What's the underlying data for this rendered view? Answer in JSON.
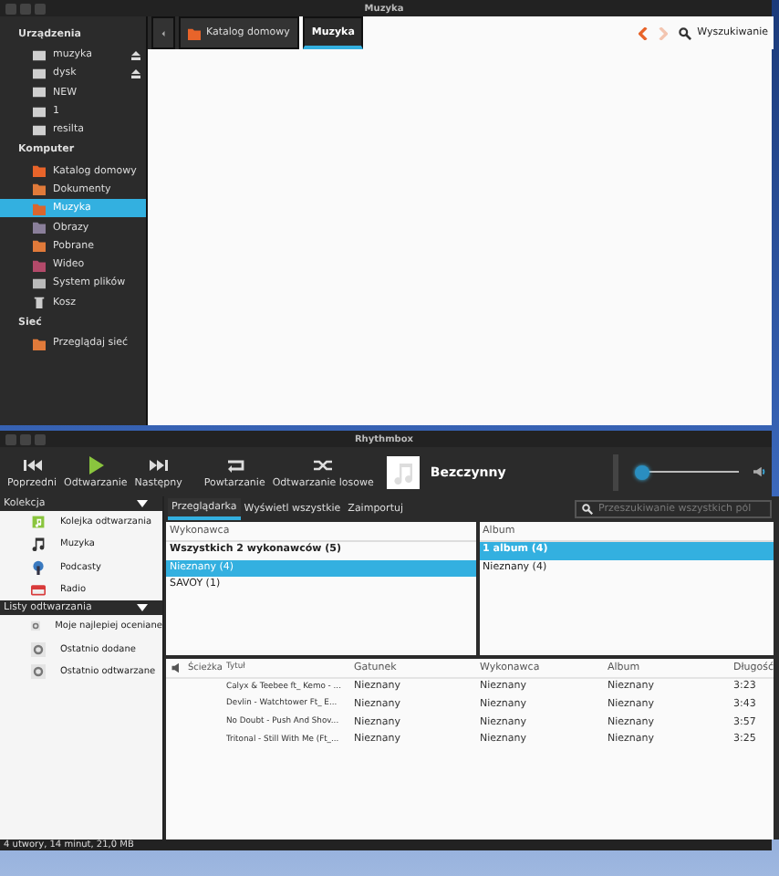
{
  "file_manager": {
    "title": "Muzyka",
    "sidebar": [
      {
        "heading": "Urządzenia",
        "items": [
          {
            "label": "muzyka",
            "ejectable": true,
            "selected": false
          },
          {
            "label": "dysk",
            "ejectable": true,
            "selected": false
          },
          {
            "label": "NEW",
            "ejectable": false,
            "selected": false
          },
          {
            "label": "1",
            "ejectable": false,
            "selected": false
          },
          {
            "label": "resilta",
            "ejectable": false,
            "selected": false
          }
        ]
      },
      {
        "heading": "Komputer",
        "items": [
          {
            "label": "Katalog domowy",
            "ejectable": false,
            "selected": false
          },
          {
            "label": "Dokumenty",
            "ejectable": false,
            "selected": false
          },
          {
            "label": "Muzyka",
            "ejectable": false,
            "selected": true
          },
          {
            "label": "Obrazy",
            "ejectable": false,
            "selected": false
          },
          {
            "label": "Pobrane",
            "ejectable": false,
            "selected": false
          },
          {
            "label": "Wideo",
            "ejectable": false,
            "selected": false
          },
          {
            "label": "System plików",
            "ejectable": false,
            "selected": false
          },
          {
            "label": "Kosz",
            "ejectable": false,
            "selected": false
          }
        ]
      },
      {
        "heading": "Sieć",
        "items": [
          {
            "label": "Przeglądaj sieć",
            "ejectable": false,
            "selected": false
          }
        ]
      }
    ],
    "pathbar": [
      {
        "label": "Katalog domowy",
        "selected": false
      },
      {
        "label": "Muzyka",
        "selected": true
      }
    ],
    "back_disabled": false,
    "forward_disabled": true,
    "search_label": "Wyszukiwanie"
  },
  "rhythmbox": {
    "title": "Rhythmbox",
    "toolbar": [
      {
        "label": "Poprzedni",
        "kind": "previous"
      },
      {
        "label": "Odtwarzanie",
        "kind": "play"
      },
      {
        "label": "Następny",
        "kind": "next"
      },
      {
        "label": "Powtarzanie",
        "kind": "repeat"
      },
      {
        "label": "Odtwarzanie losowe",
        "kind": "shuffle"
      }
    ],
    "now_playing": "Bezczynny",
    "volume": {
      "level": 0.02
    },
    "tabs": [
      {
        "label": "Przeglądarka",
        "selected": true
      },
      {
        "label": "Wyświetl wszystkie",
        "selected": false
      },
      {
        "label": "Zaimportuj",
        "selected": false
      }
    ],
    "search": {
      "placeholder": "Przeszukiwanie wszystkich pól"
    },
    "sidebar": [
      {
        "heading": "Kolekcja",
        "items": [
          {
            "label": "Kolejka odtwarzania"
          },
          {
            "label": "Muzyka"
          },
          {
            "label": "Podcasty"
          },
          {
            "label": "Radio"
          }
        ]
      },
      {
        "heading": "Listy odtwarzania",
        "items": [
          {
            "label": "Moje najlepiej oceniane"
          },
          {
            "label": "Ostatnio dodane"
          },
          {
            "label": "Ostatnio odtwarzane"
          }
        ]
      }
    ],
    "artists": {
      "header": "Wykonawca",
      "rows": [
        {
          "label": "Wszystkich 2 wykonawców (5)",
          "kind": "all",
          "selected": false
        },
        {
          "label": "Nieznany (4)",
          "kind": "item",
          "selected": true
        },
        {
          "label": "SAVOY (1)",
          "kind": "item",
          "selected": false
        }
      ]
    },
    "albums": {
      "header": "Album",
      "rows": [
        {
          "label": "1 album (4)",
          "kind": "all",
          "selected": true
        },
        {
          "label": "Nieznany (4)",
          "kind": "item",
          "selected": false
        }
      ]
    },
    "tracks": {
      "columns": [
        "Ścieżka",
        "Tytuł",
        "Gatunek",
        "Wykonawca",
        "Album",
        "Długość"
      ],
      "rows": [
        [
          "",
          "Calyx & Teebee ft_ Kemo - ...",
          "Nieznany",
          "Nieznany",
          "Nieznany",
          "3:23"
        ],
        [
          "",
          "Devlin - Watchtower Ft_ E...",
          "Nieznany",
          "Nieznany",
          "Nieznany",
          "3:43"
        ],
        [
          "",
          "No Doubt - Push And Shov...",
          "Nieznany",
          "Nieznany",
          "Nieznany",
          "3:57"
        ],
        [
          "",
          "Tritonal - Still With Me (Ft_...",
          "Nieznany",
          "Nieznany",
          "Nieznany",
          "3:25"
        ]
      ]
    },
    "status_bar": "4 utwory, 14 minut, 21,0 MB"
  }
}
